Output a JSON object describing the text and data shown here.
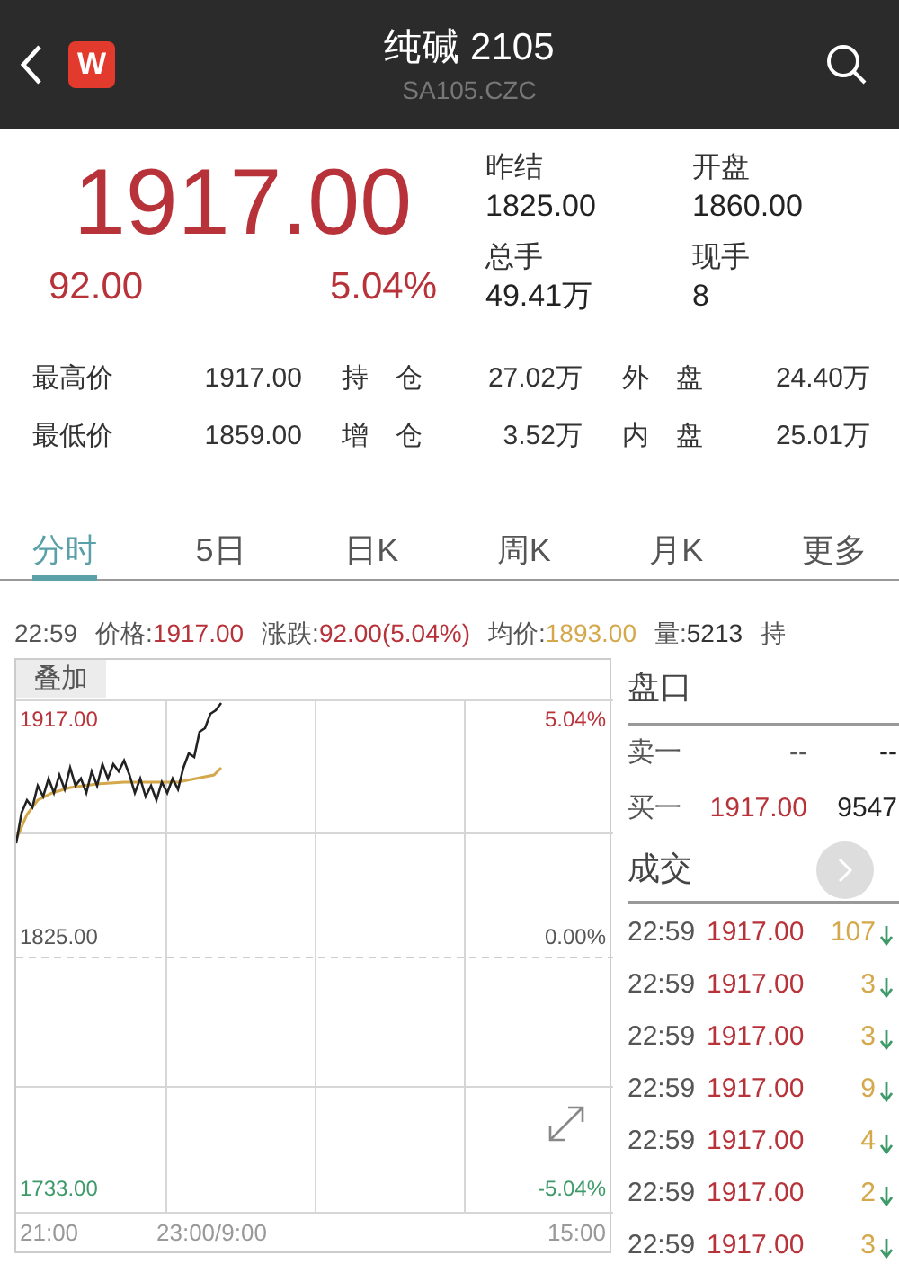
{
  "header": {
    "title": "纯碱 2105",
    "subtitle": "SA105.CZC",
    "logo": "W"
  },
  "quote": {
    "price": "1917.00",
    "change": "92.00",
    "change_pct": "5.04%"
  },
  "summary": [
    {
      "label": "昨结",
      "value": "1825.00"
    },
    {
      "label": "开盘",
      "value": "1860.00"
    },
    {
      "label": "总手",
      "value": "49.41万"
    },
    {
      "label": "现手",
      "value": "8"
    }
  ],
  "stats": [
    [
      {
        "label": "最高价",
        "value": "1917.00"
      },
      {
        "label": "持　仓",
        "value": "27.02万"
      },
      {
        "label": "外　盘",
        "value": "24.40万"
      }
    ],
    [
      {
        "label": "最低价",
        "value": "1859.00"
      },
      {
        "label": "增　仓",
        "value": "3.52万"
      },
      {
        "label": "内　盘",
        "value": "25.01万"
      }
    ]
  ],
  "tabs": [
    {
      "label": "分时",
      "selected": true
    },
    {
      "label": "5日",
      "selected": false
    },
    {
      "label": "日K",
      "selected": false
    },
    {
      "label": "周K",
      "selected": false
    },
    {
      "label": "月K",
      "selected": false
    },
    {
      "label": "更多",
      "selected": false
    }
  ],
  "info_line": [
    {
      "label": "22:59"
    },
    {
      "label": "价格:",
      "value": "1917.00",
      "color": "#b8323a"
    },
    {
      "label": "涨跌:",
      "value": "92.00(5.04%)",
      "color": "#b8323a"
    },
    {
      "label": "均价:",
      "value": "1893.00",
      "color": "#d4a84b"
    },
    {
      "label": "量:",
      "value": "5213",
      "color": "#333333"
    },
    {
      "label": "持"
    }
  ],
  "chart": {
    "overlay_button": "叠加",
    "y_labels": [
      {
        "price": "1917.00",
        "pct": "5.04%",
        "color": "#b8323a"
      },
      {
        "price": "1825.00",
        "pct": "0.00%",
        "color": "#555555"
      },
      {
        "price": "1733.00",
        "pct": "-5.04%",
        "color": "#3f9a6a"
      }
    ],
    "x_labels": [
      "21:00",
      "23:00/9:00",
      "15:00"
    ]
  },
  "order_book": {
    "title": "盘口",
    "rows": [
      {
        "label": "卖一",
        "price": "--",
        "volume": "--"
      },
      {
        "label": "买一",
        "price": "1917.00",
        "volume": "9547"
      }
    ]
  },
  "trades": {
    "title": "成交",
    "rows": [
      {
        "time": "22:59",
        "price": "1917.00",
        "volume": "107",
        "kind": "sell"
      },
      {
        "time": "22:59",
        "price": "1917.00",
        "volume": "3",
        "kind": "sell"
      },
      {
        "time": "22:59",
        "price": "1917.00",
        "volume": "3",
        "kind": "sell"
      },
      {
        "time": "22:59",
        "price": "1917.00",
        "volume": "9",
        "kind": "sell"
      },
      {
        "time": "22:59",
        "price": "1917.00",
        "volume": "4",
        "kind": "sell"
      },
      {
        "time": "22:59",
        "price": "1917.00",
        "volume": "2",
        "kind": "sell"
      },
      {
        "time": "22:59",
        "price": "1917.00",
        "volume": "3",
        "kind": "sell"
      }
    ]
  }
}
